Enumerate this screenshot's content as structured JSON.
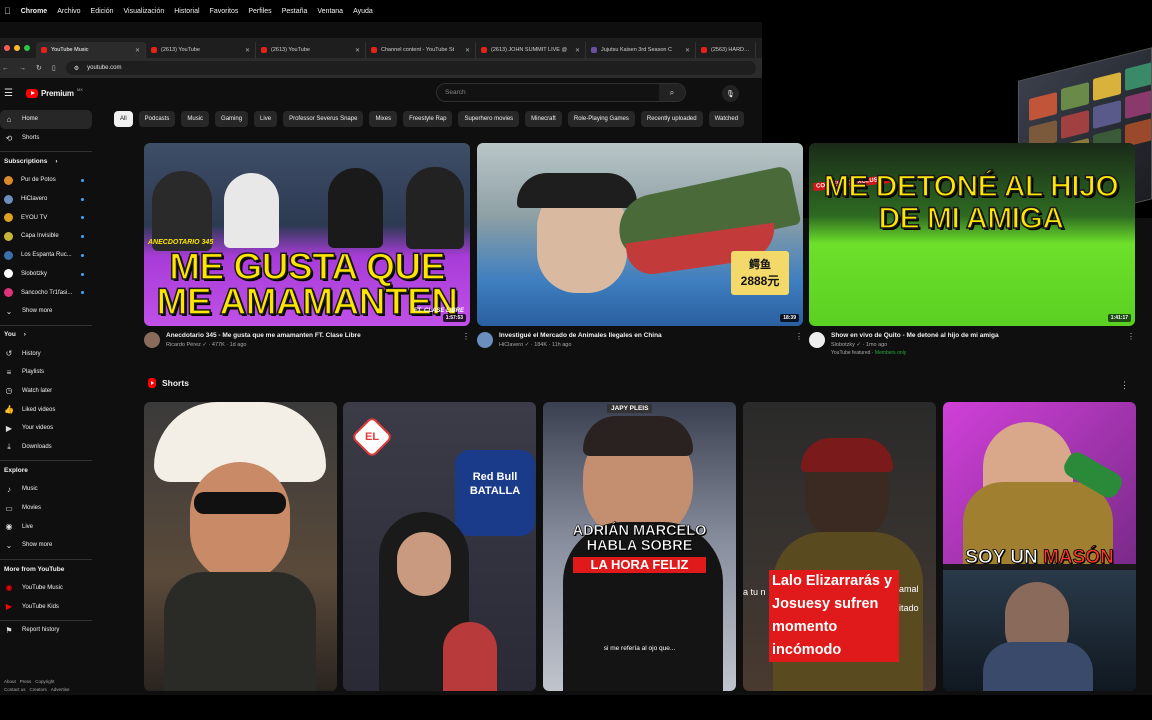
{
  "menubar": {
    "apple": "",
    "items": [
      "Chrome",
      "Archivo",
      "Edición",
      "Visualización",
      "Historial",
      "Favoritos",
      "Perfiles",
      "Pestaña",
      "Ventana",
      "Ayuda"
    ]
  },
  "tabs": [
    {
      "title": "YouTube Music",
      "active": true
    },
    {
      "title": "(2613) YouTube"
    },
    {
      "title": "(2613) YouTube"
    },
    {
      "title": "Channel content - YouTube St"
    },
    {
      "title": "(2613) JOHN SUMMIT LIVE @"
    },
    {
      "title": "Jujutsu Kaisen 3rd Season C"
    },
    {
      "title": "(2563) HARDCORE"
    }
  ],
  "address": {
    "url": "youtube.com"
  },
  "yt": {
    "logo": "Premium",
    "country": "MX",
    "search_placeholder": "Search"
  },
  "chips": [
    "All",
    "Podcasts",
    "Music",
    "Gaming",
    "Live",
    "Professor Severus Snape",
    "Mixes",
    "Freestyle Rap",
    "Superhero movies",
    "Minecraft",
    "Role-Playing Games",
    "Recently uploaded",
    "Watched"
  ],
  "sidebar": {
    "main": [
      {
        "label": "Home",
        "icon": "home-icon"
      },
      {
        "label": "Shorts",
        "icon": "shorts-icon"
      }
    ],
    "subscriptions_title": "Subscriptions",
    "subscriptions": [
      {
        "label": "Pur de Potos",
        "color": "#d98a2b"
      },
      {
        "label": "HiClavero",
        "color": "#6a8fbf"
      },
      {
        "label": "EYOU TV",
        "color": "#e0a020"
      },
      {
        "label": "Capa Invisible",
        "color": "#c9b43a"
      },
      {
        "label": "Los Espanta Ruc...",
        "color": "#3b6fa8"
      },
      {
        "label": "Slobotzky",
        "color": "#ffffff"
      },
      {
        "label": "Sancocho Tr1fasi...",
        "color": "#e0327a"
      }
    ],
    "show_more": "Show more",
    "you_title": "You",
    "you": [
      {
        "label": "History",
        "icon": "history-icon"
      },
      {
        "label": "Playlists",
        "icon": "playlists-icon"
      },
      {
        "label": "Watch later",
        "icon": "watch-later-icon"
      },
      {
        "label": "Liked videos",
        "icon": "liked-icon"
      },
      {
        "label": "Your videos",
        "icon": "your-videos-icon"
      },
      {
        "label": "Downloads",
        "icon": "downloads-icon"
      }
    ],
    "explore_title": "Explore",
    "explore": [
      {
        "label": "Music",
        "icon": "music-icon"
      },
      {
        "label": "Movies",
        "icon": "movies-icon"
      },
      {
        "label": "Live",
        "icon": "live-icon"
      }
    ],
    "explore_more": "Show more",
    "more_title": "More from YouTube",
    "more": [
      {
        "label": "YouTube Music",
        "icon": "youtube-music-icon"
      },
      {
        "label": "YouTube Kids",
        "icon": "youtube-kids-icon"
      }
    ],
    "report": "Report history",
    "footer1": [
      "About",
      "Press",
      "Copyright"
    ],
    "footer2": [
      "Contact us",
      "Creators",
      "Advertise"
    ]
  },
  "videos": [
    {
      "title": "Anecdotario 345 - Me gusta que me amamanten FT. Clase Libre",
      "channel": "Ricardo Pérez",
      "stats": "477K · 1d ago",
      "duration": "1:57:53",
      "thumb_text": "ME GUSTA QUE ME AMAMANTEN",
      "thumb_tag": "ANECDOTARIO 345",
      "thumb_ft": "FT. CLASE LIBRE"
    },
    {
      "title": "Investigué el Mercado de Animales Ilegales en China",
      "channel": "HiClavero",
      "stats": "184K · 11h ago",
      "duration": "18:39",
      "thumb_sign1": "鳄鱼",
      "thumb_sign2": "2888元"
    },
    {
      "title": "Show en vivo de Quito - Me detoné al hijo de mi amiga",
      "channel": "Slobotzky",
      "stats": "1mo ago",
      "featured": "YouTube featured",
      "members": "Members only",
      "duration": "1:41:17",
      "thumb_text": "ME DETONÉ AL HIJO DE MI AMIGA",
      "thumb_tag": "CONTENIDO EXCLUSIVO"
    }
  ],
  "shorts": {
    "title": "Shorts",
    "items": [
      {
        "caption": ""
      },
      {
        "caption": "",
        "badge": "EL",
        "logo": "Red Bull BATALLA"
      },
      {
        "caption_top": "JAPY PLEIS",
        "caption": "ADRIÁN MARCELO HABLA SOBRE",
        "caption_hl": "LA HORA FELIZ",
        "sub": "si me refería al ojo que..."
      },
      {
        "caption": "Lalo Elizarrarás y Josuesy sufren momento incómodo",
        "side_left": "a tu n",
        "side_right": "amal",
        "side_right2": "itado"
      },
      {
        "caption": "SOY UN",
        "caption_hl": "MASÓN"
      }
    ]
  }
}
